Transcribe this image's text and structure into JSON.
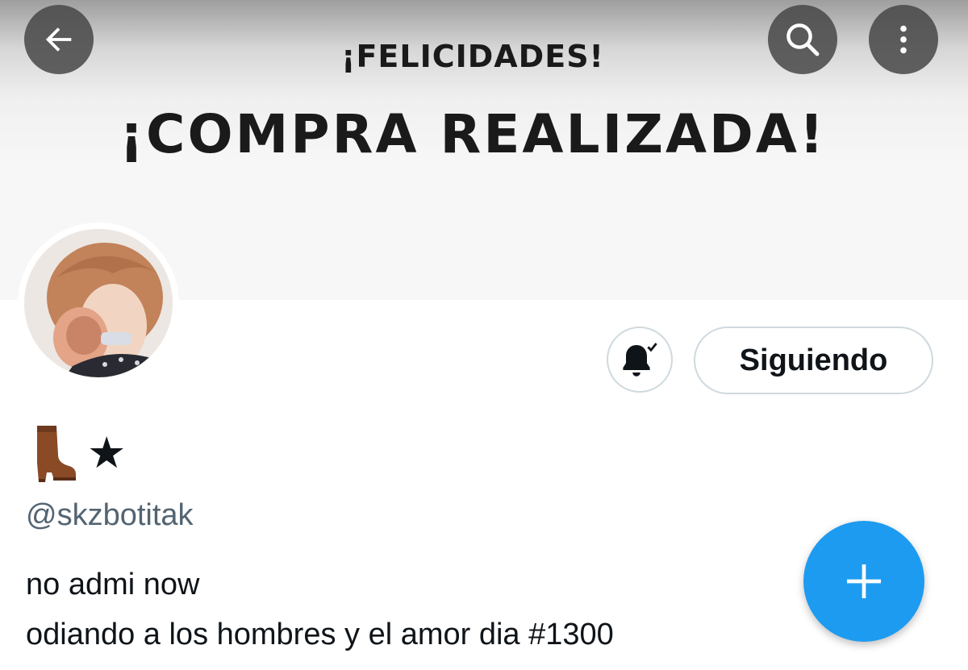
{
  "header": {
    "back_icon": "arrow-left-icon",
    "search_icon": "search-icon",
    "more_icon": "more-vertical-icon"
  },
  "banner": {
    "line1": "¡FELICIDADES!",
    "line2": "¡COMPRA REALIZADA!"
  },
  "profile": {
    "avatar_alt": "profile photo",
    "notifications_icon": "bell-check-icon",
    "follow_label": "Siguiendo",
    "display_name_star": "★",
    "display_name_emoji": "boot-icon",
    "handle": "@skzbotitak",
    "bio": [
      "no admi now",
      "odiando a los hombres y el amor dia #1300"
    ]
  },
  "fab": {
    "icon": "plus-icon"
  },
  "colors": {
    "accent": "#1d9bf0",
    "text_primary": "#0f1419",
    "text_secondary": "#536471",
    "border": "#cfd9de"
  }
}
